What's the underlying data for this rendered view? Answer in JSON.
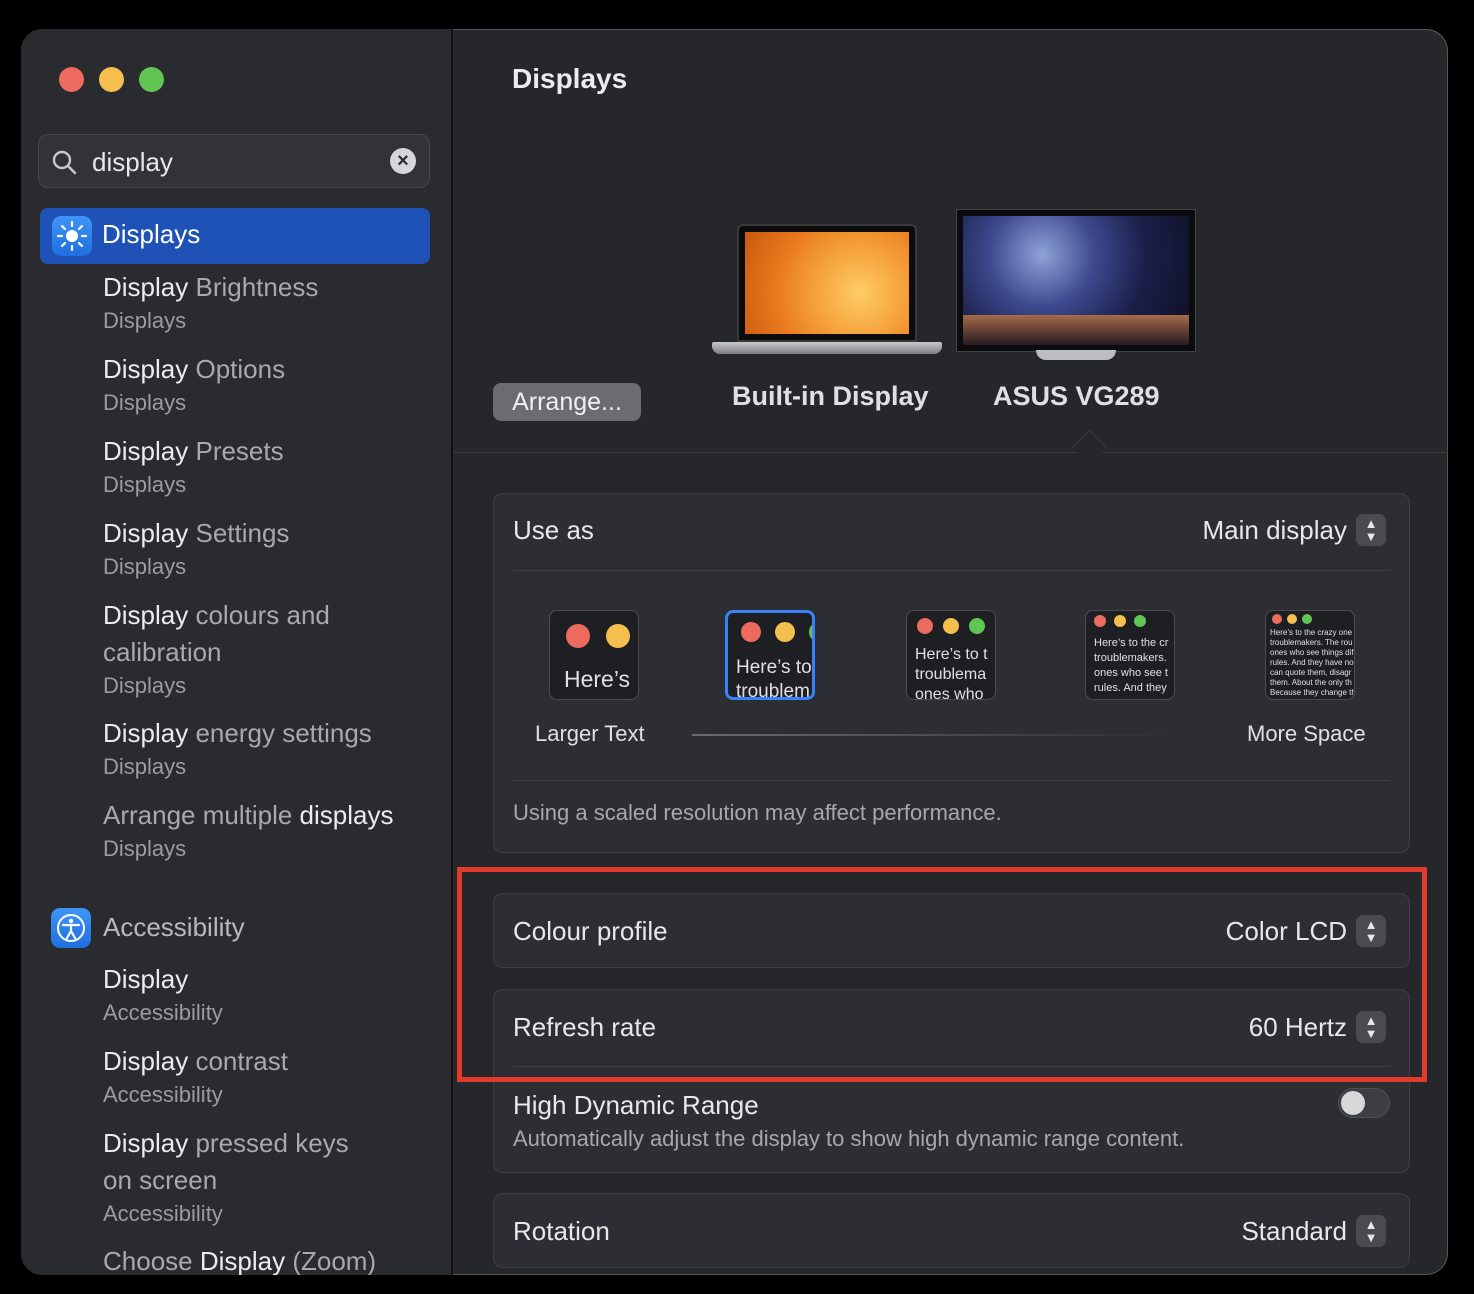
{
  "search": {
    "value": "display"
  },
  "sidebar": {
    "selected": {
      "label": "Displays"
    },
    "results": [
      {
        "match": "Display",
        "rest": " Brightness",
        "category": "Displays"
      },
      {
        "match": "Display",
        "rest": " Options",
        "category": "Displays"
      },
      {
        "match": "Display",
        "rest": " Presets",
        "category": "Displays"
      },
      {
        "match": "Display",
        "rest": " Settings",
        "category": "Displays"
      },
      {
        "match": "Display",
        "rest": " colours and",
        "rest2": "calibration",
        "category": "Displays"
      },
      {
        "match": "Display",
        "rest": " energy settings",
        "category": "Displays"
      },
      {
        "prefix": "Arrange multiple ",
        "match": "display",
        "rest": "s",
        "category": "Displays"
      }
    ],
    "accessibility": {
      "label": "Accessibility",
      "results": [
        {
          "match": "Display",
          "rest": "",
          "category": "Accessibility"
        },
        {
          "match": "Display",
          "rest": " contrast",
          "category": "Accessibility"
        },
        {
          "match": "Display",
          "rest": " pressed keys",
          "rest2": "on screen",
          "category": "Accessibility"
        },
        {
          "prefix": "Choose ",
          "match": "Display",
          "rest": " (Zoom)"
        }
      ]
    }
  },
  "main": {
    "title": "Displays",
    "arrange_button": "Arrange...",
    "displays": [
      "Built-in Display",
      "ASUS VG289"
    ],
    "use_as": {
      "label": "Use as",
      "value": "Main display"
    },
    "scaling": {
      "thumb_texts": [
        "Here’s",
        "Here’s to",
        "troublem",
        "Here’s to t",
        "troublema",
        "ones who",
        "Here’s to the cr",
        "troublemakers.",
        "ones who see t",
        "rules. And they",
        "Here’s to the crazy one",
        "troublemakers. The rou",
        "ones who see things dif",
        "rules. And they have no",
        "can quote them, disagr",
        "them. About the only th",
        "Because they change th"
      ],
      "left_label": "Larger Text",
      "right_label": "More Space"
    },
    "note": "Using a scaled resolution may affect performance.",
    "colour_profile": {
      "label": "Colour profile",
      "value": "Color LCD"
    },
    "refresh_rate": {
      "label": "Refresh rate",
      "value": "60 Hertz"
    },
    "hdr": {
      "label": "High Dynamic Range",
      "description": "Automatically adjust the display to show high dynamic range content.",
      "enabled": false
    },
    "rotation": {
      "label": "Rotation",
      "value": "Standard"
    }
  },
  "colors": {
    "accent": "#1f52b6",
    "highlight": "#e23a2c"
  }
}
